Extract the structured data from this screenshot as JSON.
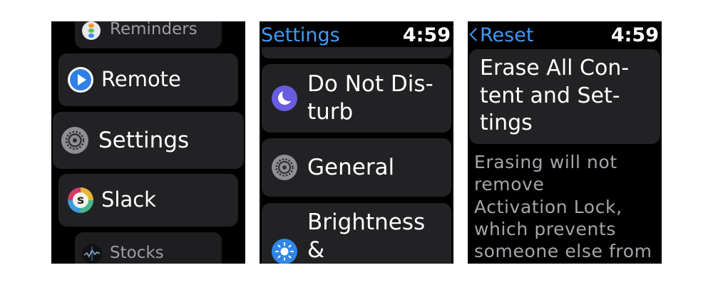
{
  "screen_apps": {
    "items": [
      {
        "label": "Reminders",
        "icon": "reminders-icon"
      },
      {
        "label": "Remote",
        "icon": "remote-icon"
      },
      {
        "label": "Settings",
        "icon": "gear-icon"
      },
      {
        "label": "Slack",
        "icon": "slack-icon"
      },
      {
        "label": "Stocks",
        "icon": "stocks-icon"
      }
    ]
  },
  "screen_settings": {
    "header_title": "Settings",
    "time": "4:59",
    "items": [
      {
        "label_lines": [
          "Do Not Dis-",
          "turb"
        ],
        "icon": "moon-icon"
      },
      {
        "label_lines": [
          "General"
        ],
        "icon": "gear-icon"
      },
      {
        "label_lines": [
          "Brightness",
          "&"
        ],
        "icon": "sun-icon"
      }
    ]
  },
  "screen_reset": {
    "back_label": "Reset",
    "back_icon": "chevron-left-icon",
    "time": "4:59",
    "erase_button_lines": [
      "Erase All Con-",
      "tent and Set-",
      "tings"
    ],
    "description_lines": [
      "Erasing will not",
      "remove",
      "Activation Lock,",
      "which prevents",
      "someone else from"
    ]
  },
  "colors": {
    "accent": "#3e9bf7",
    "cell": "#222224",
    "muted_text": "#a5a5aa"
  }
}
